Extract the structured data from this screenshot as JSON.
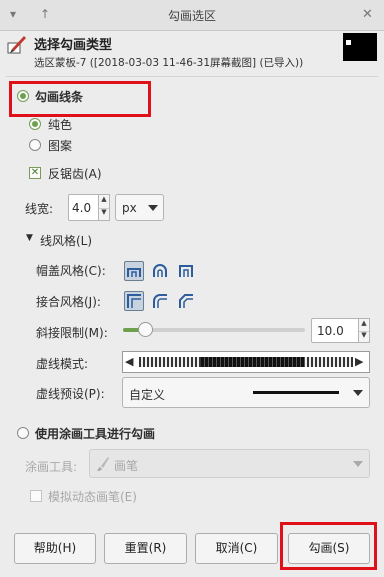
{
  "window": {
    "title": "勾画选区",
    "pin_icon": "pin-icon",
    "up_icon": "up-arrow-icon",
    "close_icon": "close-icon"
  },
  "header": {
    "title": "选择勾画类型",
    "subtitle": "选区蒙板-7 ([2018-03-03 11-46-31屏幕截图] (已导入))"
  },
  "stroke_line": {
    "label": "勾画线条",
    "selected": true,
    "solid_label": "纯色",
    "pattern_label": "图案",
    "antialias_label": "反锯齿(A)",
    "antialias_checked": true,
    "width_label": "线宽:",
    "width_value": "4.0",
    "unit_value": "px",
    "line_style_label": "线风格(L)",
    "cap_style_label": "帽盖风格(C):",
    "join_style_label": "接合风格(J):",
    "miter_label": "斜接限制(M):",
    "miter_value": "10.0",
    "miter_fraction": 0.12,
    "dash_pattern_label": "虚线模式:",
    "dash_preset_label": "虚线预设(P):",
    "dash_preset_value": "自定义"
  },
  "paint_tool": {
    "label": "使用涂画工具进行勾画",
    "tool_label": "涂画工具:",
    "tool_value": "画笔",
    "emulate_label": "模拟动态画笔(E)"
  },
  "buttons": {
    "help": "帮助(H)",
    "reset": "重置(R)",
    "cancel": "取消(C)",
    "stroke": "勾画(S)"
  },
  "colors": {
    "highlight": "#e0101a",
    "accent_green": "#6ea04d"
  }
}
